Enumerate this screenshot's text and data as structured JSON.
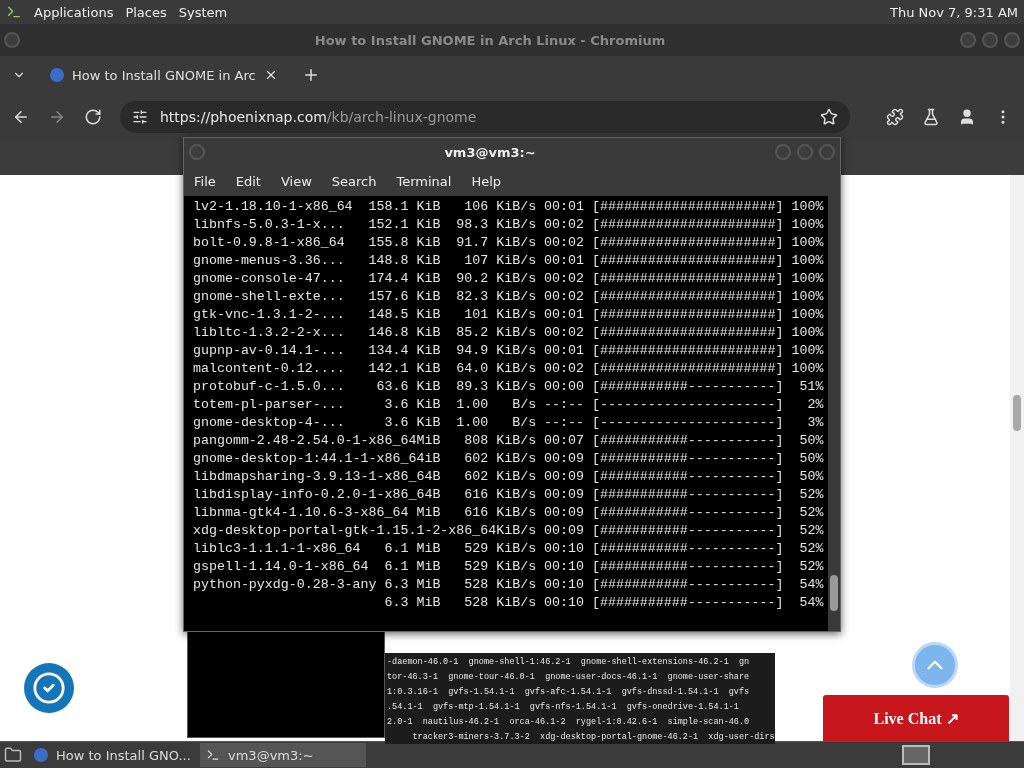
{
  "top_panel": {
    "menus": [
      "Applications",
      "Places",
      "System"
    ],
    "clock": "Thu Nov 7, 9:31 AM"
  },
  "browser": {
    "window_title": "How to Install GNOME in Arch Linux - Chromium",
    "tabs": [
      {
        "label": "How to Install GNOME in Arc",
        "selected": true
      }
    ],
    "url_host": "https://phoenixnap.com",
    "url_path": "/kb/arch-linux-gnome"
  },
  "page": {
    "code_lines": [
      "-daemon-46.0-1  gnome-shell-1:46.2-1  gnome-shell-extensions-46.2-1  gn",
      "tor-46.3-1  gnome-tour-46.0-1  gnome-user-docs-46.1-1  gnome-user-share",
      "1:0.3.16-1  gvfs-1.54.1-1  gvfs-afc-1.54.1-1  gvfs-dnssd-1.54.1-1  gvfs",
      ".54.1-1  gvfs-mtp-1.54.1-1  gvfs-nfs-1.54.1-1  gvfs-onedrive-1.54.1-1",
      "2.0-1  nautilus-46.2-1  orca-46.1-2  rygel-1:0.42.6-1  simple-scan-46.0",
      "     tracker3-miners-3.7.3-2  xdg-desktop-portal-gnome-46.2-1  xdg-user-dirs"
    ],
    "live_chat": "Live Chat ↗"
  },
  "terminal": {
    "title": "vm3@vm3:~",
    "menus": [
      "File",
      "Edit",
      "View",
      "Search",
      "Terminal",
      "Help"
    ],
    "lines": [
      {
        "kind": "full",
        "text": "lv2-1.18.10-1-x86_64  158.1 KiB   106 KiB/s 00:01 [######################] 100%"
      },
      {
        "kind": "full",
        "text": "libnfs-5.0.3-1-x...   152.1 KiB  98.3 KiB/s 00:02 [######################] 100%"
      },
      {
        "kind": "full",
        "text": "bolt-0.9.8-1-x86_64   155.8 KiB  91.7 KiB/s 00:02 [######################] 100%"
      },
      {
        "kind": "full",
        "text": "gnome-menus-3.36...   148.8 KiB   107 KiB/s 00:01 [######################] 100%"
      },
      {
        "kind": "full",
        "text": "gnome-console-47...   174.4 KiB  90.2 KiB/s 00:02 [######################] 100%"
      },
      {
        "kind": "full",
        "text": "gnome-shell-exte...   157.6 KiB  82.3 KiB/s 00:02 [######################] 100%"
      },
      {
        "kind": "full",
        "text": "gtk-vnc-1.3.1-2-...   148.5 KiB   101 KiB/s 00:01 [######################] 100%"
      },
      {
        "kind": "full",
        "text": "libltc-1.3.2-2-x...   146.8 KiB  85.2 KiB/s 00:02 [######################] 100%"
      },
      {
        "kind": "full",
        "text": "gupnp-av-0.14.1-...   134.4 KiB  94.9 KiB/s 00:01 [######################] 100%"
      },
      {
        "kind": "full",
        "text": "malcontent-0.12....   142.1 KiB  64.0 KiB/s 00:02 [######################] 100%"
      },
      {
        "kind": "full",
        "text": "protobuf-c-1.5.0...    63.6 KiB  89.3 KiB/s 00:00 [###########-----------]  51%"
      },
      {
        "kind": "full",
        "text": "totem-pl-parser-...     3.6 KiB  1.00   B/s --:-- [----------------------]   2%"
      },
      {
        "kind": "full",
        "text": "gnome-desktop-4-...     3.6 KiB  1.00   B/s --:-- [----------------------]   3%"
      },
      {
        "kind": "full",
        "text": "pangomm-2.48-2.54.0-1-x86_64MiB   808 KiB/s 00:07 [###########-----------]  50%"
      },
      {
        "kind": "full",
        "text": "gnome-desktop-1:44.1-1-x86_64iB   602 KiB/s 00:09 [###########-----------]  50%"
      },
      {
        "kind": "full",
        "text": "libdmapsharing-3.9.13-1-x86_64B   602 KiB/s 00:09 [###########-----------]  50%"
      },
      {
        "kind": "full",
        "text": "libdisplay-info-0.2.0-1-x86_64B   616 KiB/s 00:09 [###########-----------]  52%"
      },
      {
        "kind": "full",
        "text": "libnma-gtk4-1.10.6-3-x86_64 MiB   616 KiB/s 00:09 [###########-----------]  52%"
      },
      {
        "kind": "full",
        "text": "xdg-desktop-portal-gtk-1.15.1-2-x86_64KiB/s 00:09 [###########-----------]  52%"
      },
      {
        "kind": "full",
        "text": "liblc3-1.1.1-1-x86_64   6.1 MiB   529 KiB/s 00:10 [###########-----------]  52%"
      },
      {
        "kind": "full",
        "text": "gspell-1.14.0-1-x86_64  6.1 MiB   529 KiB/s 00:10 [###########-----------]  52%"
      },
      {
        "kind": "full",
        "text": "python-pyxdg-0.28-3-any 6.3 MiB   528 KiB/s 00:10 [###########-----------]  54%"
      },
      {
        "kind": "partial",
        "text": "6.3 MiB   528 KiB/s 00:10 [###########-----------]  54%"
      }
    ]
  },
  "taskbar": {
    "items": [
      {
        "kind": "browser",
        "label": "How to Install GNO...",
        "selected": false
      },
      {
        "kind": "terminal",
        "label": "vm3@vm3:~",
        "selected": true
      }
    ]
  }
}
